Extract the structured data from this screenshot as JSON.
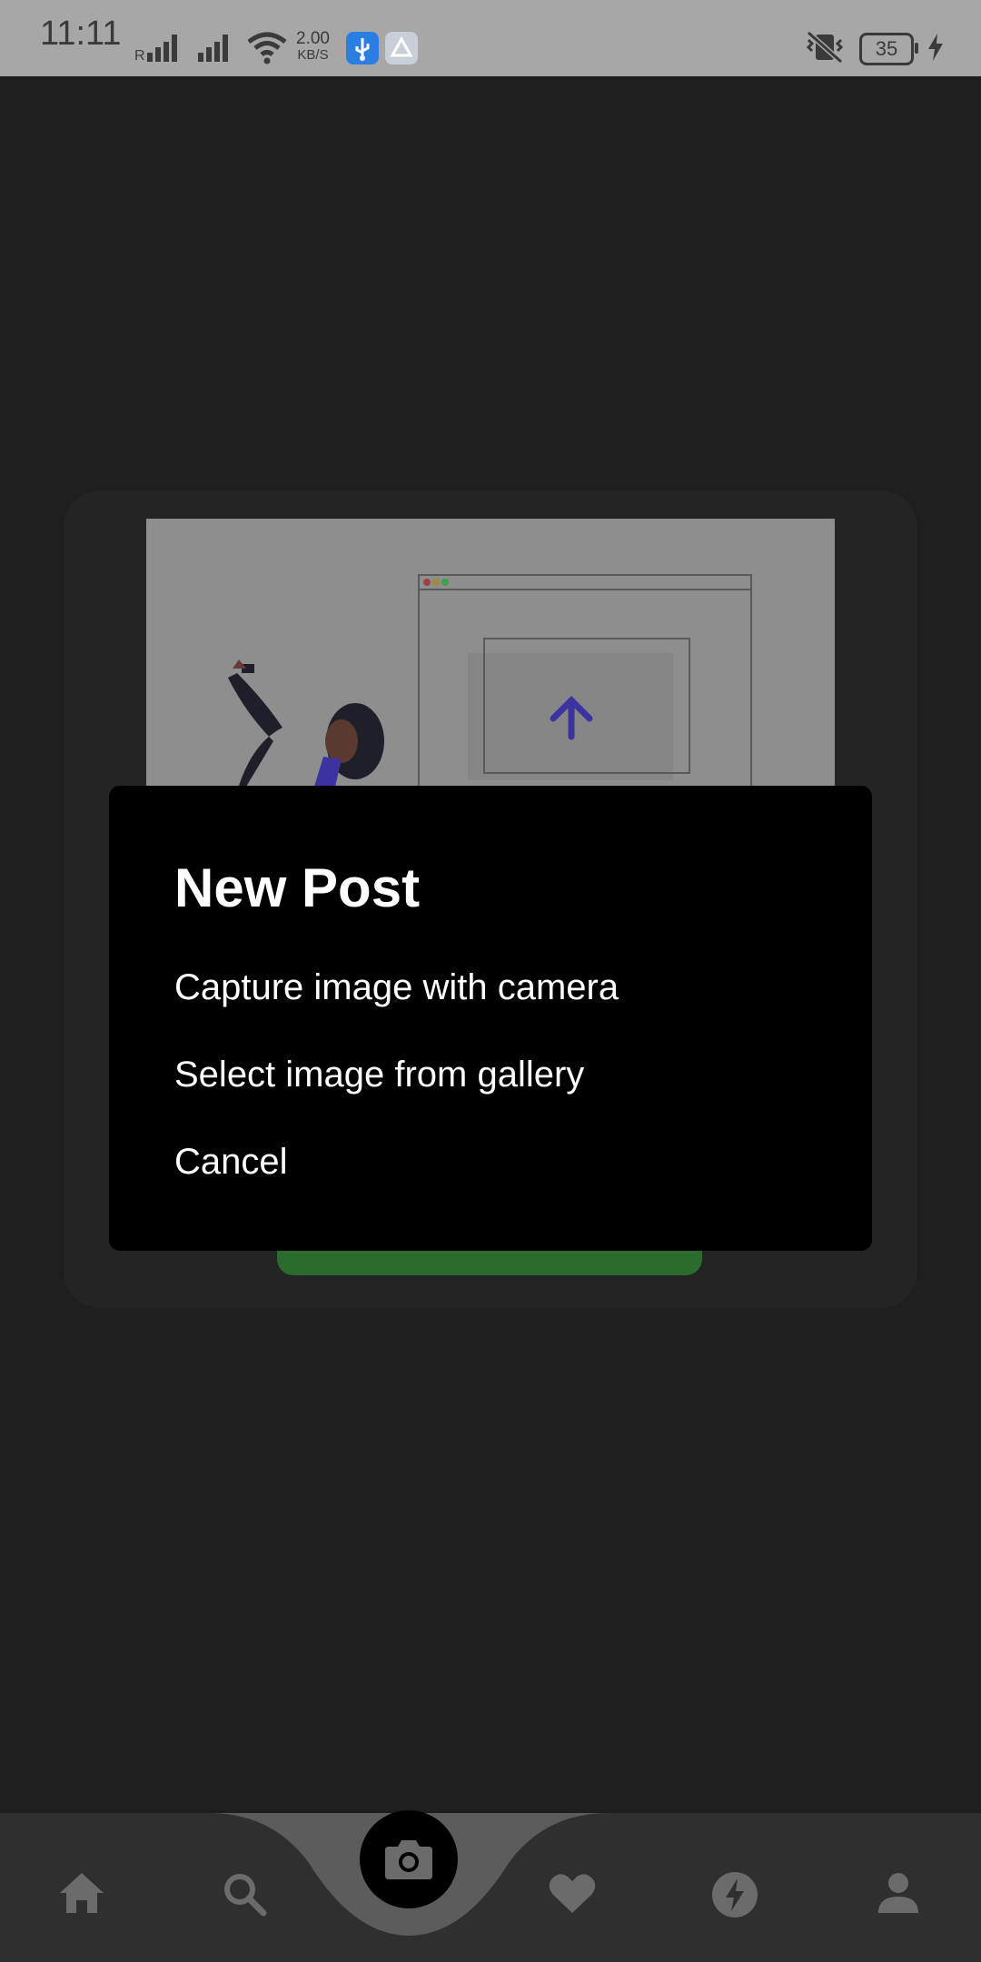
{
  "status_bar": {
    "time": "11:11",
    "network_speed_value": "2.00",
    "network_speed_unit": "KB/S",
    "battery_level": "35",
    "icons": [
      "signal-icon",
      "wifi-icon",
      "usb-icon",
      "app-icon",
      "vibrate-icon",
      "battery-icon",
      "charging-icon"
    ]
  },
  "dialog": {
    "title": "New Post",
    "options": [
      {
        "label": "Capture image with camera"
      },
      {
        "label": "Select image from gallery"
      },
      {
        "label": "Cancel"
      }
    ]
  },
  "bottom_nav": {
    "items": [
      "home-icon",
      "search-icon",
      "camera-icon",
      "heart-icon",
      "flash-icon",
      "profile-icon"
    ]
  },
  "colors": {
    "background": "#1e1e1e",
    "dialog": "#000000",
    "nav_bar": "#2f2f2f",
    "accent_purple": "#4b3fc9",
    "button_green": "#2a6b2e"
  }
}
